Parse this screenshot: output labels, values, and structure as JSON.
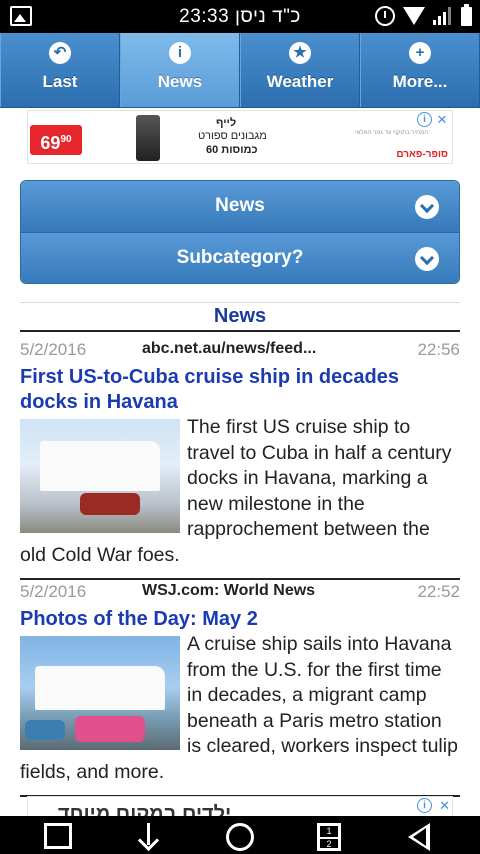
{
  "status_bar": {
    "time_text": "23:33 כ\"ד ניסן",
    "icons": [
      "gallery-icon",
      "alarm-icon",
      "wifi-icon",
      "signal-icon",
      "battery-icon"
    ]
  },
  "tabs": [
    {
      "label": "Last",
      "icon": "back-arrow-icon",
      "glyph": "↶",
      "active": false
    },
    {
      "label": "News",
      "icon": "info-icon",
      "glyph": "i",
      "active": true
    },
    {
      "label": "Weather",
      "icon": "star-icon",
      "glyph": "★",
      "active": false
    },
    {
      "label": "More...",
      "icon": "plus-icon",
      "glyph": "+",
      "active": false
    }
  ],
  "ad_top": {
    "price": "69",
    "price_cents": "90",
    "line1": "לייף",
    "line2": "מגבונים ספורט",
    "line3": "60 כמוסות",
    "fine_print": "המחיר בתוקף עד גמר המלאי",
    "brand": "סופר-פארם",
    "info_glyph": "i",
    "close_glyph": "✕"
  },
  "selectors": {
    "category_label": "News",
    "subcategory_label": "Subcategory?"
  },
  "section_title": "News",
  "articles": [
    {
      "date": "5/2/2016",
      "source": "abc.net.au/news/feed...",
      "time": "22:56",
      "headline": "First US-to-Cuba cruise ship in decades docks in Havana",
      "body": "The first US cruise ship to travel to Cuba in half a century docks in Havana, marking a new milestone in the rapprochement between the old Cold War foes."
    },
    {
      "date": "5/2/2016",
      "source": "WSJ.com: World News",
      "time": "22:52",
      "headline": "Photos of the Day: May 2",
      "body": "A cruise ship sails into Havana from the U.S. for the first time in decades, a migrant camp beneath a Paris metro station is cleared, workers inspect tulip fields, and more."
    }
  ],
  "ad_bottom": {
    "text": "ילדים במקום מיוחד",
    "info_glyph": "i",
    "close_glyph": "✕"
  },
  "nav_bar": {
    "split_top": "1",
    "split_bottom": "2"
  },
  "colors": {
    "tab_bar": "#3a7fc0",
    "tab_active": "#6dabe2",
    "headline": "#1b3bb3",
    "section_title": "#1b3b9c"
  }
}
